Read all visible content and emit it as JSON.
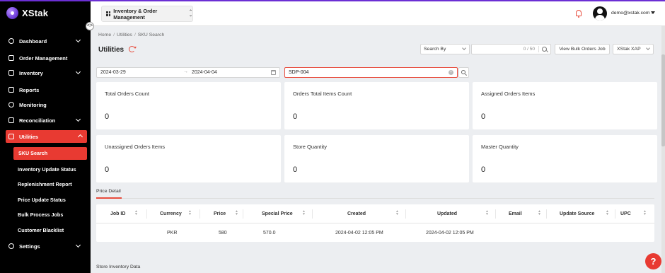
{
  "app": {
    "logo_text": "XStak",
    "brand_color": "#e83a32",
    "accent_purple": "#6b2fd4"
  },
  "sidebar": {
    "collapse_icon": "<>",
    "items": [
      {
        "label": "Dashboard",
        "icon": "dashboard-icon",
        "has_chevron": true
      },
      {
        "label": "Order Management",
        "icon": "box-icon",
        "has_chevron": false
      },
      {
        "label": "Inventory",
        "icon": "inventory-icon",
        "has_chevron": true
      },
      {
        "label": "Reports",
        "icon": "report-icon",
        "has_chevron": false
      },
      {
        "label": "Monitoring",
        "icon": "monitor-icon",
        "has_chevron": false
      },
      {
        "label": "Reconciliation",
        "icon": "reconcile-icon",
        "has_chevron": true
      },
      {
        "label": "Utilities",
        "icon": "utilities-icon",
        "has_chevron": true,
        "active": true
      },
      {
        "label": "Settings",
        "icon": "gear-icon",
        "has_chevron": true
      }
    ],
    "sub_items": [
      {
        "label": "SKU Search",
        "active": true
      },
      {
        "label": "Inventory Update Status"
      },
      {
        "label": "Replenishment Report"
      },
      {
        "label": "Price Update Status"
      },
      {
        "label": "Bulk Process Jobs"
      },
      {
        "label": "Customer Blacklist"
      }
    ]
  },
  "header": {
    "module_label": "Inventory & Order Management",
    "user_email": "demo@xstak.com ."
  },
  "breadcrumb": {
    "home": "Home",
    "utilities": "Utilities",
    "current": "SKU Search",
    "separator": "/"
  },
  "page": {
    "title": "Utilities"
  },
  "toolbar": {
    "search_by_placeholder": "Search By",
    "search_counter": "0 / 50",
    "bulk_button": "View Bulk Orders Job",
    "store_select": "XStak XAP"
  },
  "filters": {
    "date_from": "2024-03-29",
    "date_arrow": "→",
    "date_to": "2024-04-04",
    "sku_value": "SDP-004",
    "clear_icon": "×"
  },
  "stats": [
    {
      "label": "Total Orders Count",
      "value": "0"
    },
    {
      "label": "Orders Total Items Count",
      "value": "0"
    },
    {
      "label": "Assigned Orders Items",
      "value": "0"
    },
    {
      "label": "Unassigned Orders Items",
      "value": "0"
    },
    {
      "label": "Store Quantity",
      "value": "0"
    },
    {
      "label": "Master Quantity",
      "value": "0"
    }
  ],
  "price_detail": {
    "tab_label": "Price Detail",
    "columns": [
      "Job ID",
      "Currency",
      "Price",
      "Special Price",
      "Created",
      "Updated",
      "Email",
      "Update Source",
      "UPC"
    ],
    "sort_icon": "▲▼",
    "rows": [
      {
        "job_id": "",
        "currency": "PKR",
        "price": "580",
        "special_price": "570.0",
        "created": "2024-04-02 12:05 PM",
        "updated": "2024-04-02 12:05 PM",
        "email": "",
        "update_source": "",
        "upc": ""
      }
    ]
  },
  "store_inventory": {
    "label": "Store Inventory Data"
  },
  "help": {
    "label": "?"
  }
}
